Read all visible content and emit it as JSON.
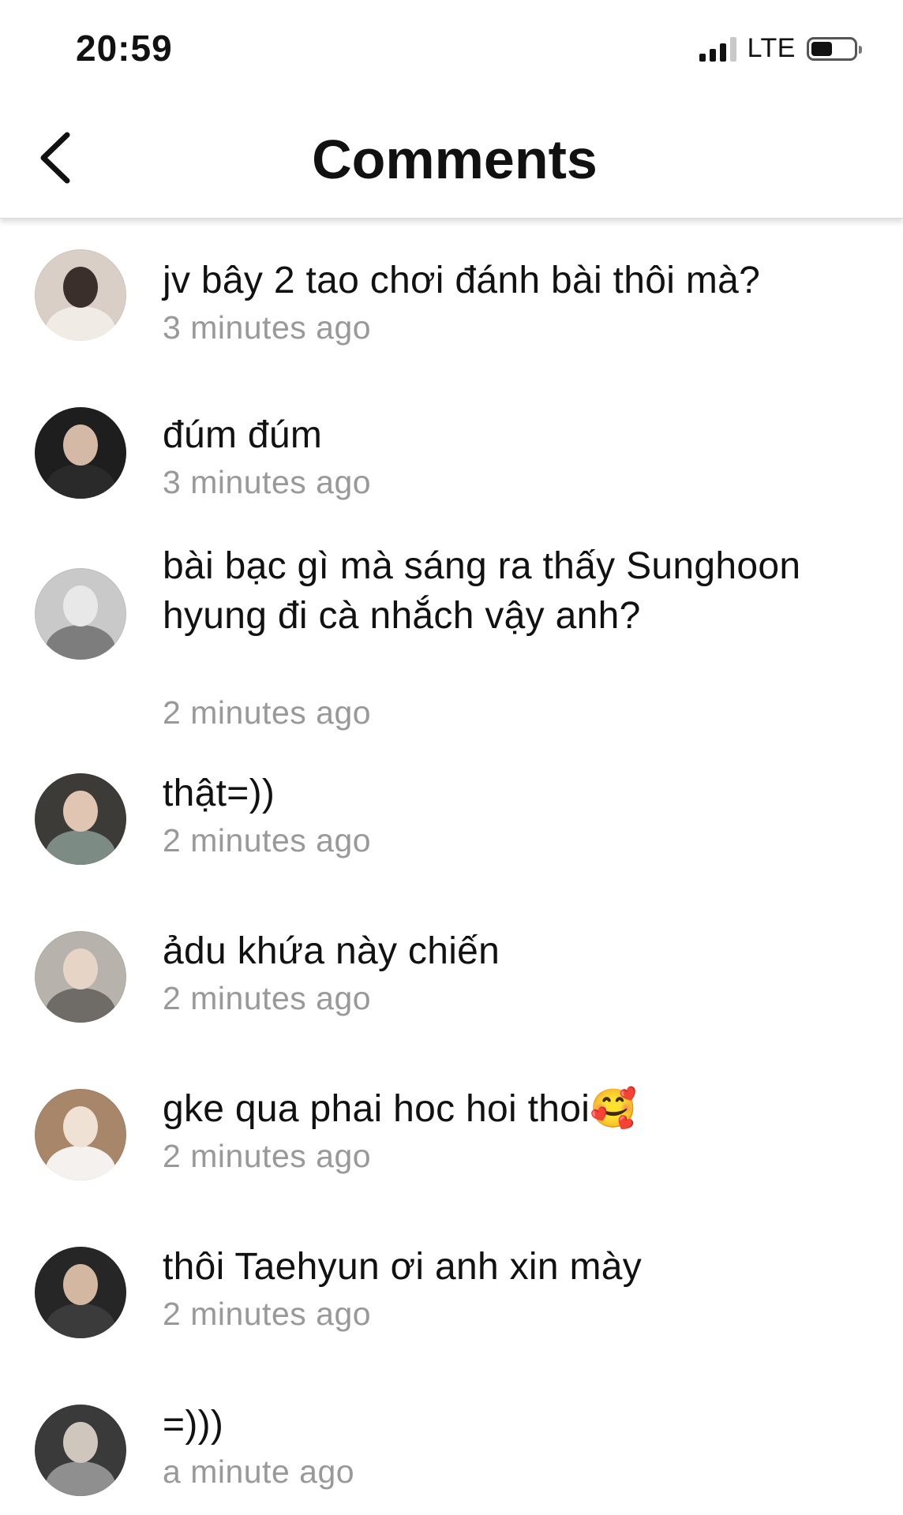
{
  "status_bar": {
    "time": "20:59",
    "network": "LTE"
  },
  "header": {
    "title": "Comments"
  },
  "comments": [
    {
      "text": "jv bây 2 tao chơi đánh bài thôi mà?",
      "time": "3 minutes ago",
      "avatar_colors": [
        "#d9cfc6",
        "#3a2f2a",
        "#f1ebe6"
      ]
    },
    {
      "text": "đúm đúm",
      "time": "3 minutes ago",
      "avatar_colors": [
        "#1e1e1e",
        "#d4b9a6",
        "#2a2a2a"
      ]
    },
    {
      "text": "bài bạc gì mà sáng ra thấy Sunghoon hyung đi cà nhắch vậy anh?",
      "time": "2 minutes ago",
      "avatar_colors": [
        "#c9c9c9",
        "#e8e8e8",
        "#7d7d7d"
      ]
    },
    {
      "text": "thật=))",
      "time": "2 minutes ago",
      "avatar_colors": [
        "#3d3b38",
        "#e0c6b2",
        "#7c8c84"
      ]
    },
    {
      "text": "ảdu khứa này chiến",
      "time": "2 minutes ago",
      "avatar_colors": [
        "#b7b3ac",
        "#e6d4c6",
        "#6f6b66"
      ]
    },
    {
      "text": "gke qua phai hoc hoi thoi🥰",
      "time": "2 minutes ago",
      "avatar_colors": [
        "#a7866a",
        "#efe2d4",
        "#f4f1ee"
      ]
    },
    {
      "text": "thôi Taehyun ơi anh xin mày",
      "time": "2 minutes ago",
      "avatar_colors": [
        "#262626",
        "#d3b7a1",
        "#3b3b3b"
      ]
    },
    {
      "text": "=)))",
      "time": "a minute ago",
      "avatar_colors": [
        "#3a3a3a",
        "#cfc6bd",
        "#8f8f8f"
      ]
    }
  ]
}
